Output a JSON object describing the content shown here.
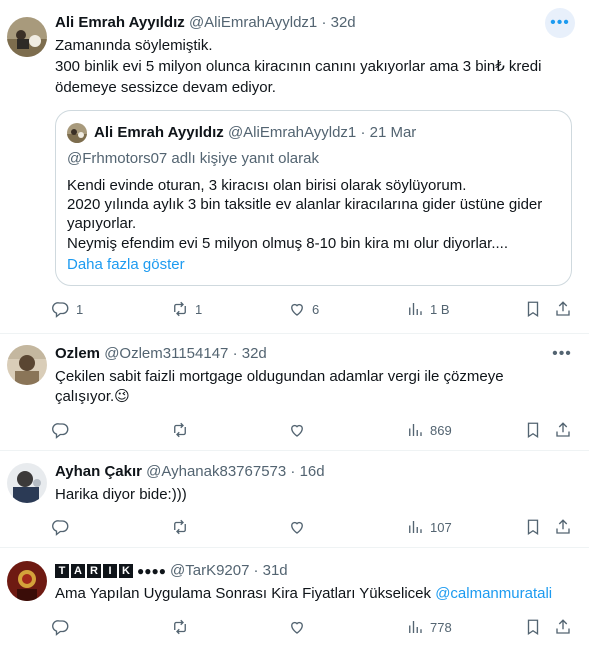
{
  "tweets": [
    {
      "name": "Ali Emrah Ayyıldız",
      "handle": "@AliEmrahAyyldz1",
      "date": "· 32d",
      "lines": [
        "Zamanında söylemiştik.",
        "300 binlik evi 5 milyon olunca kiracının canını yakıyorlar ama 3 bin₺ kredi",
        "ödemeye sessizce devam ediyor."
      ],
      "quote": {
        "name": "Ali Emrah Ayyıldız",
        "handle": "@AliEmrahAyyldz1",
        "date": "· 21 Mar",
        "reply_to": "@Frhmotors07 adlı kişiye yanıt olarak",
        "lines": [
          "Kendi evinde oturan, 3 kiracısı olan birisi olarak söylüyorum.",
          "2020 yılında aylık 3 bin taksitle ev alanlar kiracılarına gider üstüne gider",
          "yapıyorlar.",
          "Neymiş efendim evi 5 milyon olmuş 8-10 bin kira mı olur diyorlar...."
        ],
        "show_more": "Daha fazla göster"
      },
      "stats": {
        "replies": "1",
        "retweets": "1",
        "likes": "6",
        "views": "1 B"
      }
    },
    {
      "name": "Ozlem",
      "handle": "@Ozlem31154147",
      "date": "· 32d",
      "lines": [
        "Çekilen sabit faizli mortgage oldugundan adamlar vergi ile çözmeye",
        "çalışıyor.😉"
      ],
      "stats": {
        "replies": "",
        "retweets": "",
        "likes": "",
        "views": "869"
      }
    },
    {
      "name": "Ayhan Çakır",
      "handle": "@Ayhanak83767573",
      "date": "· 16d",
      "lines": [
        "Harika diyor bide:)))"
      ],
      "stats": {
        "replies": "",
        "retweets": "",
        "likes": "",
        "views": "107"
      }
    },
    {
      "name_letters": [
        "T",
        "A",
        "R",
        "I",
        "K"
      ],
      "name_dots": "●●●●",
      "handle": "@TarK9207",
      "date": "· 31d",
      "text": "Ama Yapılan Uygulama Sonrası Kira Fiyatları Yükselicek",
      "mention": "@calmanmuratali",
      "stats": {
        "replies": "",
        "retweets": "",
        "likes": "",
        "views": "778"
      }
    }
  ],
  "icons": {
    "more": "more-dots-icon",
    "reply": "reply-icon",
    "retweet": "retweet-icon",
    "like": "heart-icon",
    "views": "views-bar-chart-icon",
    "bookmark": "bookmark-icon",
    "share": "share-icon"
  },
  "colors": {
    "link": "#1d9bf0",
    "secondary_text": "#536471",
    "border": "#eff3f4"
  }
}
